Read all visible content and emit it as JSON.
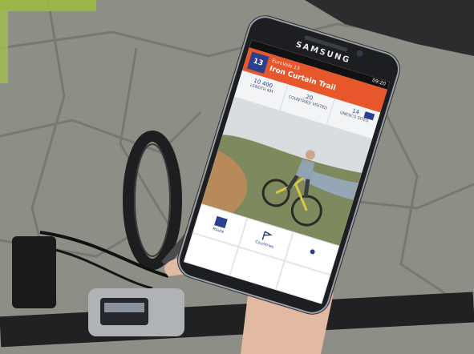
{
  "phone": {
    "brand": "SAMSUNG",
    "status_time": "09:20",
    "app": {
      "badge": "13",
      "subtitle": "EuroVelo 13",
      "title": "Iron Curtain Trail",
      "stats": [
        {
          "value": "10 400",
          "label": "LENGTH KM"
        },
        {
          "value": "20",
          "label": "COUNTRIES VISITED"
        },
        {
          "value": "14",
          "label": "UNESCO SITES"
        }
      ],
      "tiles": [
        "Route",
        "Countries",
        "",
        "",
        "",
        ""
      ]
    }
  },
  "icons": [
    "eu-flag-icon",
    "route-icon",
    "flag-icon",
    "location-pin-icon"
  ],
  "colors": {
    "header_orange": "#e8562c",
    "eurovelo_blue": "#2c3f8e",
    "pavement": "#8f9088"
  }
}
